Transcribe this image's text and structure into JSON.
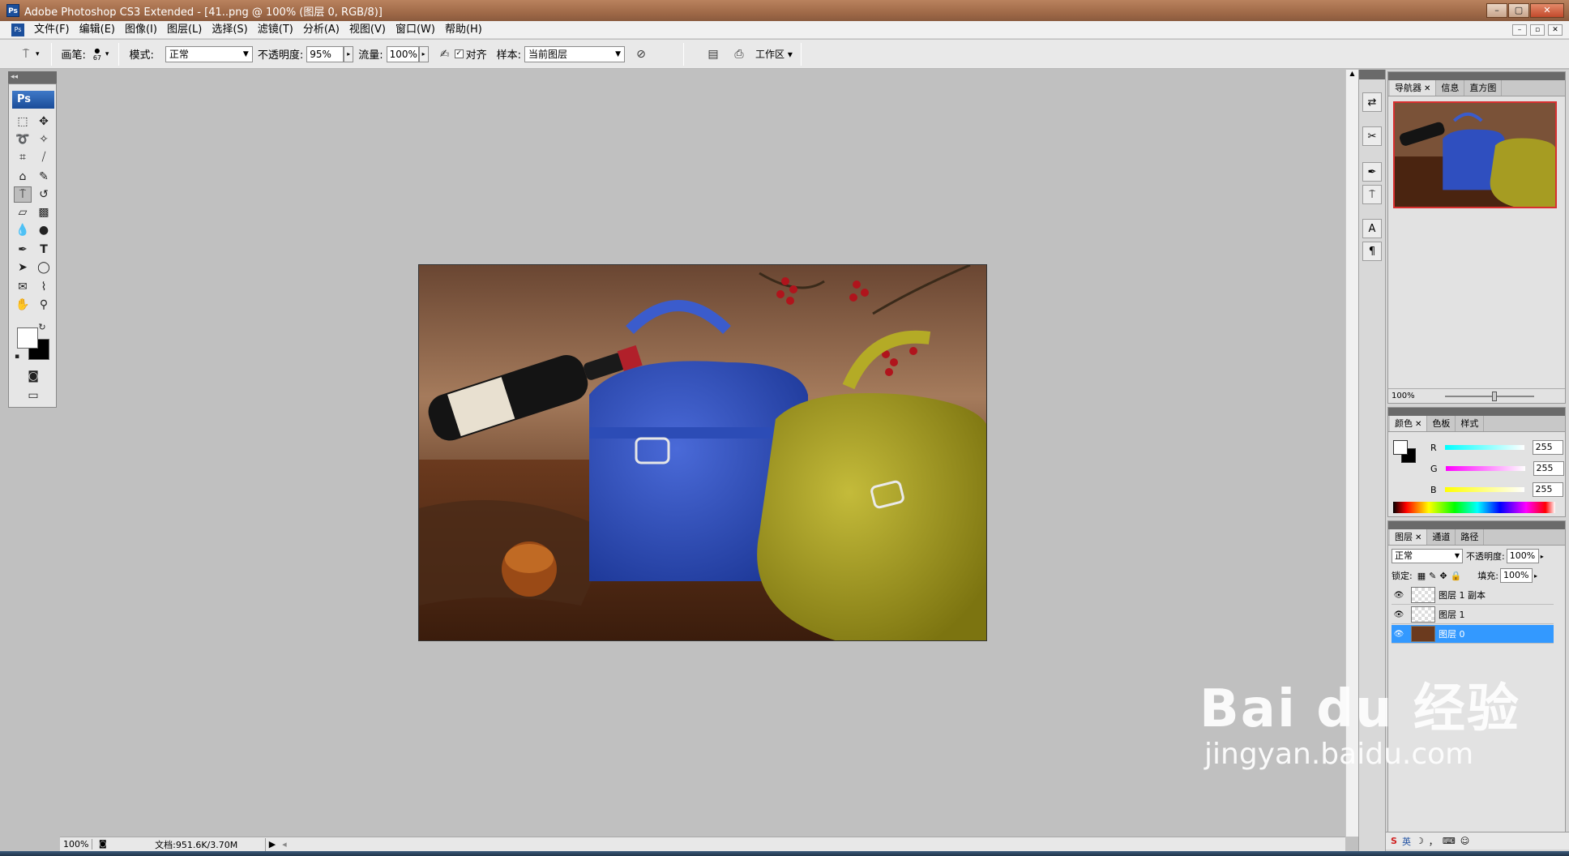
{
  "window": {
    "title": "Adobe Photoshop CS3 Extended - [41..png @ 100% (图层 0, RGB/8)]",
    "app_icon": "Ps"
  },
  "menu": [
    "文件(F)",
    "编辑(E)",
    "图像(I)",
    "图层(L)",
    "选择(S)",
    "滤镜(T)",
    "分析(A)",
    "视图(V)",
    "窗口(W)",
    "帮助(H)"
  ],
  "options": {
    "brush_label": "画笔:",
    "brush_size": "67",
    "mode_label": "模式:",
    "mode_value": "正常",
    "opacity_label": "不透明度:",
    "opacity_value": "95%",
    "flow_label": "流量:",
    "flow_value": "100%",
    "aligned_label": "对齐",
    "sample_label": "样本:",
    "sample_value": "当前图层",
    "workspace_label": "工作区 ▾"
  },
  "toolbox": {
    "logo": "Ps"
  },
  "status": {
    "zoom": "100%",
    "doc": "文档:951.6K/3.70M"
  },
  "navigator": {
    "tabs": [
      "导航器",
      "信息",
      "直方图"
    ],
    "zoom": "100%"
  },
  "color_panel": {
    "tabs": [
      "颜色",
      "色板",
      "样式"
    ],
    "channels": [
      {
        "label": "R",
        "value": "255"
      },
      {
        "label": "G",
        "value": "255"
      },
      {
        "label": "B",
        "value": "255"
      }
    ]
  },
  "layers_panel": {
    "tabs": [
      "图层",
      "通道",
      "路径"
    ],
    "blend_mode": "正常",
    "opacity_label": "不透明度:",
    "opacity_value": "100%",
    "lock_label": "锁定:",
    "fill_label": "填充:",
    "fill_value": "100%",
    "layers": [
      {
        "name": "图层 1 副本",
        "selected": false
      },
      {
        "name": "图层 1",
        "selected": false
      },
      {
        "name": "图层 0",
        "selected": true
      }
    ]
  },
  "watermark": {
    "brand": "Bai du 经验",
    "url": "jingyan.baidu.com"
  },
  "ime": {
    "label": "英"
  }
}
